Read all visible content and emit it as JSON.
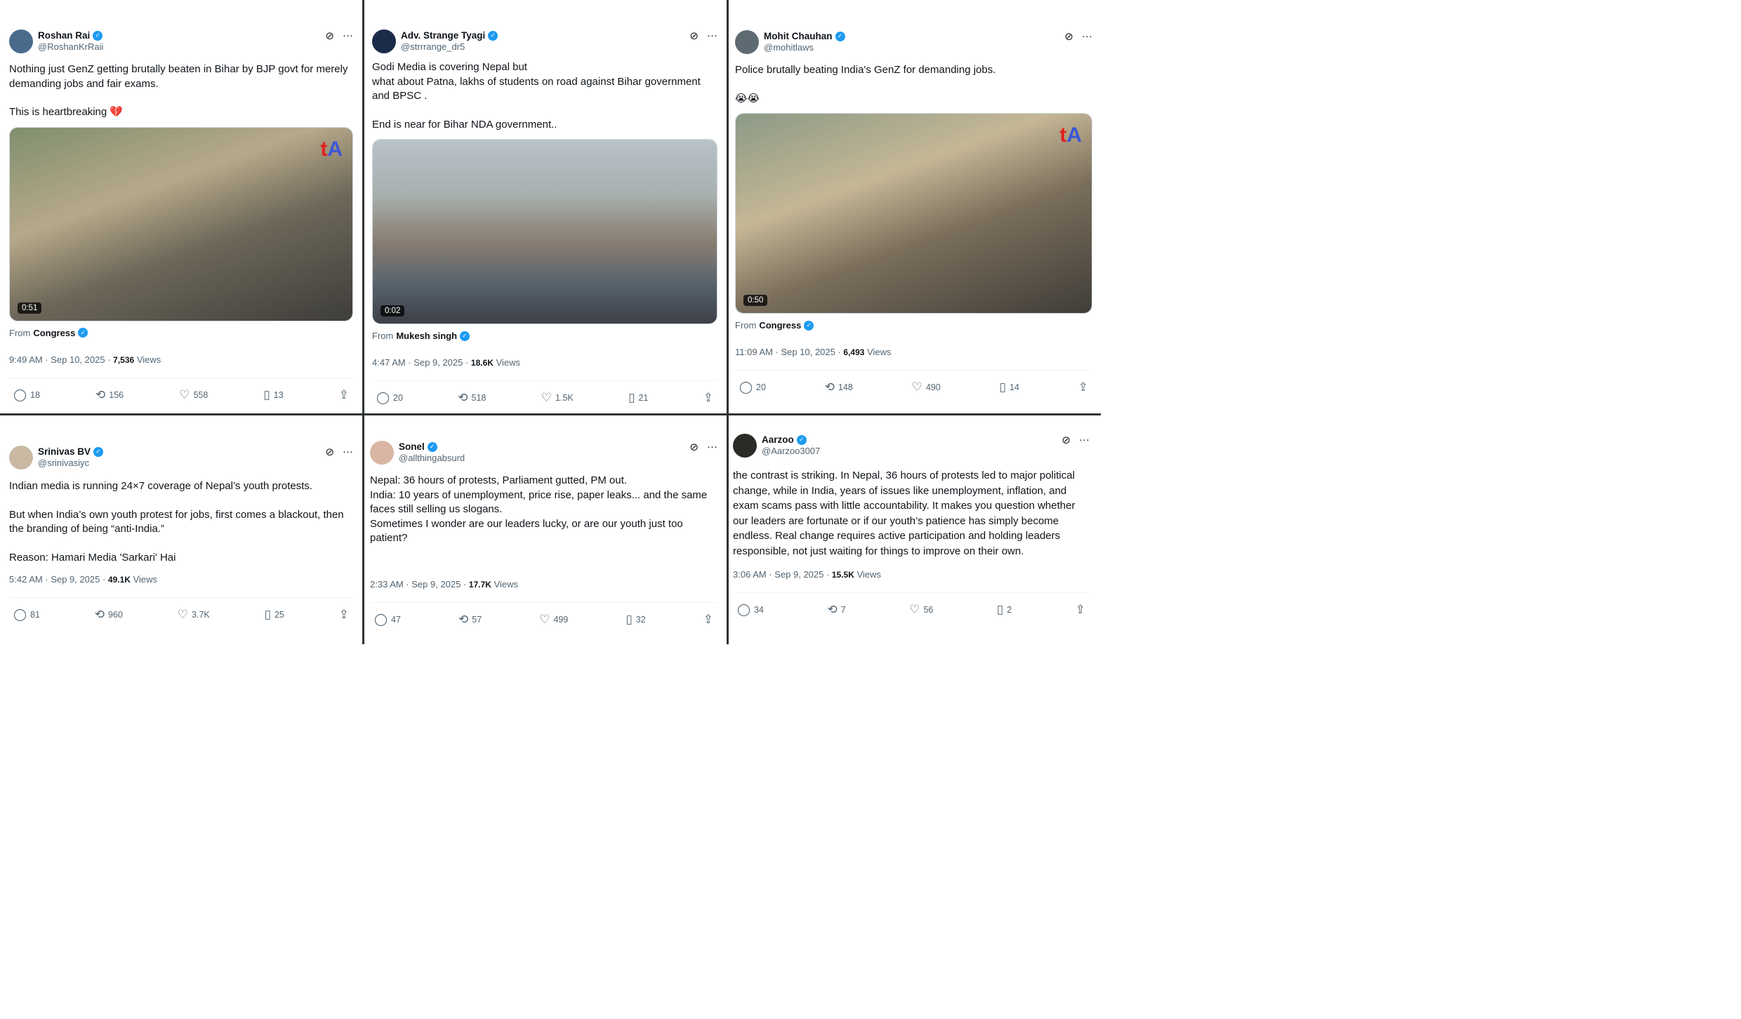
{
  "icons": {
    "grok": "⊘",
    "more": "···",
    "reply": "💬",
    "retweet": "⟲",
    "like": "♡",
    "bookmark": "⊓",
    "share": "⇪",
    "verified": "✓"
  },
  "labels": {
    "from": "From",
    "views": "Views"
  },
  "tweets": [
    {
      "name": "Roshan Rai",
      "handle": "@RoshanKrRaii",
      "avatar_color": "#4a6b8c",
      "paragraphs": [
        "Nothing just GenZ getting brutally beaten in Bihar by BJP govt for merely demanding jobs and fair exams.",
        "",
        "This is heartbreaking 💔"
      ],
      "duration": "0:51",
      "from": "Congress",
      "date": "9:49 AM · Sep 10, 2025 · ",
      "views": "7,536",
      "replies": "18",
      "retweets": "156",
      "likes": "558",
      "bookmarks": "13"
    },
    {
      "name": "Adv. Strange Tyagi",
      "handle": "@strrrange_dr5",
      "avatar_color": "#1c2a4a",
      "paragraphs": [
        "Godi Media is covering Nepal but\nwhat about Patna, lakhs of students on road against Bihar government and BPSC .",
        "",
        "End is near for Bihar NDA government.."
      ],
      "duration": "0:02",
      "from": "Mukesh singh",
      "date": "4:47 AM · Sep 9, 2025 · ",
      "views": "18.6K",
      "replies": "20",
      "retweets": "518",
      "likes": "1.5K",
      "bookmarks": "21"
    },
    {
      "name": "Mohit Chauhan",
      "handle": "@mohitlaws",
      "avatar_color": "#5e6a72",
      "paragraphs": [
        "Police brutally beating India's GenZ for demanding jobs.",
        "",
        "😭😭"
      ],
      "duration": "0:50",
      "from": "Congress",
      "date": "11:09 AM · Sep 10, 2025 · ",
      "views": "6,493",
      "replies": "20",
      "retweets": "148",
      "likes": "490",
      "bookmarks": "14"
    },
    {
      "name": "Srinivas BV",
      "handle": "@srinivasiyc",
      "avatar_color": "#c9b9a2",
      "paragraphs": [
        "Indian media is running 24×7 coverage of Nepal’s youth protests.",
        "",
        "But when India’s own youth protest for jobs, first comes a blackout, then the branding of being “anti-India.”",
        "",
        "Reason: Hamari Media 'Sarkari' Hai"
      ],
      "date": "5:42 AM · Sep 9, 2025 · ",
      "views": "49.1K",
      "replies": "81",
      "retweets": "960",
      "likes": "3.7K",
      "bookmarks": "25"
    },
    {
      "name": "Sonel",
      "handle": "@allthingabsurd",
      "avatar_color": "#d9b6a3",
      "paragraphs": [
        "Nepal: 36 hours of protests, Parliament gutted, PM out.\nIndia: 10 years of unemployment, price rise, paper leaks... and the same faces still selling us slogans.\nSometimes I wonder are our leaders lucky, or are our youth just too patient?"
      ],
      "date": "2:33 AM · Sep 9, 2025 · ",
      "views": "17.7K",
      "replies": "47",
      "retweets": "57",
      "likes": "499",
      "bookmarks": "32"
    },
    {
      "name": "Aarzoo",
      "handle": "@Aarzoo3007",
      "avatar_color": "#2b2a27",
      "paragraphs": [
        "the contrast is striking. In Nepal, 36 hours of protests led to major political change, while in India, years of issues like unemployment, inflation, and exam scams pass with little accountability. It makes you question whether our leaders are fortunate or if our youth’s patience has simply become endless. Real change requires active participation and holding leaders responsible, not just waiting for things to improve on their own."
      ],
      "date": "3:06 AM · Sep 9, 2025 · ",
      "views": "15.5K",
      "replies": "34",
      "retweets": "7",
      "likes": "56",
      "bookmarks": "2"
    }
  ]
}
